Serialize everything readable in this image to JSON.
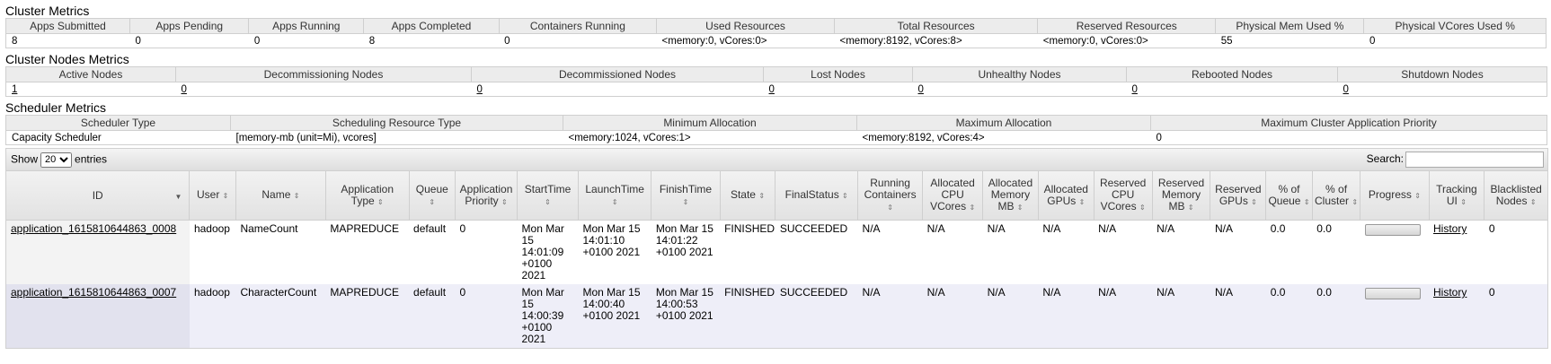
{
  "cluster_metrics": {
    "title": "Cluster Metrics",
    "headers": [
      "Apps Submitted",
      "Apps Pending",
      "Apps Running",
      "Apps Completed",
      "Containers Running",
      "Used Resources",
      "Total Resources",
      "Reserved Resources",
      "Physical Mem Used %",
      "Physical VCores Used %"
    ],
    "values": [
      "8",
      "0",
      "0",
      "8",
      "0",
      "<memory:0, vCores:0>",
      "<memory:8192, vCores:8>",
      "<memory:0, vCores:0>",
      "55",
      "0"
    ]
  },
  "cluster_nodes_metrics": {
    "title": "Cluster Nodes Metrics",
    "headers": [
      "Active Nodes",
      "Decommissioning Nodes",
      "Decommissioned Nodes",
      "Lost Nodes",
      "Unhealthy Nodes",
      "Rebooted Nodes",
      "Shutdown Nodes"
    ],
    "values": [
      "1",
      "0",
      "0",
      "0",
      "0",
      "0",
      "0"
    ]
  },
  "scheduler_metrics": {
    "title": "Scheduler Metrics",
    "headers": [
      "Scheduler Type",
      "Scheduling Resource Type",
      "Minimum Allocation",
      "Maximum Allocation",
      "Maximum Cluster Application Priority"
    ],
    "values": [
      "Capacity Scheduler",
      "[memory-mb (unit=Mi), vcores]",
      "<memory:1024, vCores:1>",
      "<memory:8192, vCores:4>",
      "0"
    ]
  },
  "apps_table": {
    "show_label": "Show",
    "entries_value": "20",
    "entries_label": "entries",
    "search_label": "Search:",
    "search_value": "",
    "columns": [
      "ID",
      "User",
      "Name",
      "Application Type",
      "Queue",
      "Application Priority",
      "StartTime",
      "LaunchTime",
      "FinishTime",
      "State",
      "FinalStatus",
      "Running Containers",
      "Allocated CPU VCores",
      "Allocated Memory MB",
      "Allocated GPUs",
      "Reserved CPU VCores",
      "Reserved Memory MB",
      "Reserved GPUs",
      "% of Queue",
      "% of Cluster",
      "Progress",
      "Tracking UI",
      "Blacklisted Nodes"
    ],
    "rows": [
      {
        "id": "application_1615810644863_0008",
        "user": "hadoop",
        "name": "NameCount",
        "type": "MAPREDUCE",
        "queue": "default",
        "priority": "0",
        "start": "Mon Mar 15 14:01:09 +0100 2021",
        "launch": "Mon Mar 15 14:01:10 +0100 2021",
        "finish": "Mon Mar 15 14:01:22 +0100 2021",
        "state": "FINISHED",
        "final_status": "SUCCEEDED",
        "running_containers": "N/A",
        "alloc_vcores": "N/A",
        "alloc_mem": "N/A",
        "alloc_gpus": "N/A",
        "res_vcores": "N/A",
        "res_mem": "N/A",
        "res_gpus": "N/A",
        "pct_queue": "0.0",
        "pct_cluster": "0.0",
        "progress": 0,
        "tracking": "History",
        "blacklisted": "0"
      },
      {
        "id": "application_1615810644863_0007",
        "user": "hadoop",
        "name": "CharacterCount",
        "type": "MAPREDUCE",
        "queue": "default",
        "priority": "0",
        "start": "Mon Mar 15 14:00:39 +0100 2021",
        "launch": "Mon Mar 15 14:00:40 +0100 2021",
        "finish": "Mon Mar 15 14:00:53 +0100 2021",
        "state": "FINISHED",
        "final_status": "SUCCEEDED",
        "running_containers": "N/A",
        "alloc_vcores": "N/A",
        "alloc_mem": "N/A",
        "alloc_gpus": "N/A",
        "res_vcores": "N/A",
        "res_mem": "N/A",
        "res_gpus": "N/A",
        "pct_queue": "0.0",
        "pct_cluster": "0.0",
        "progress": 0,
        "tracking": "History",
        "blacklisted": "0"
      }
    ]
  }
}
